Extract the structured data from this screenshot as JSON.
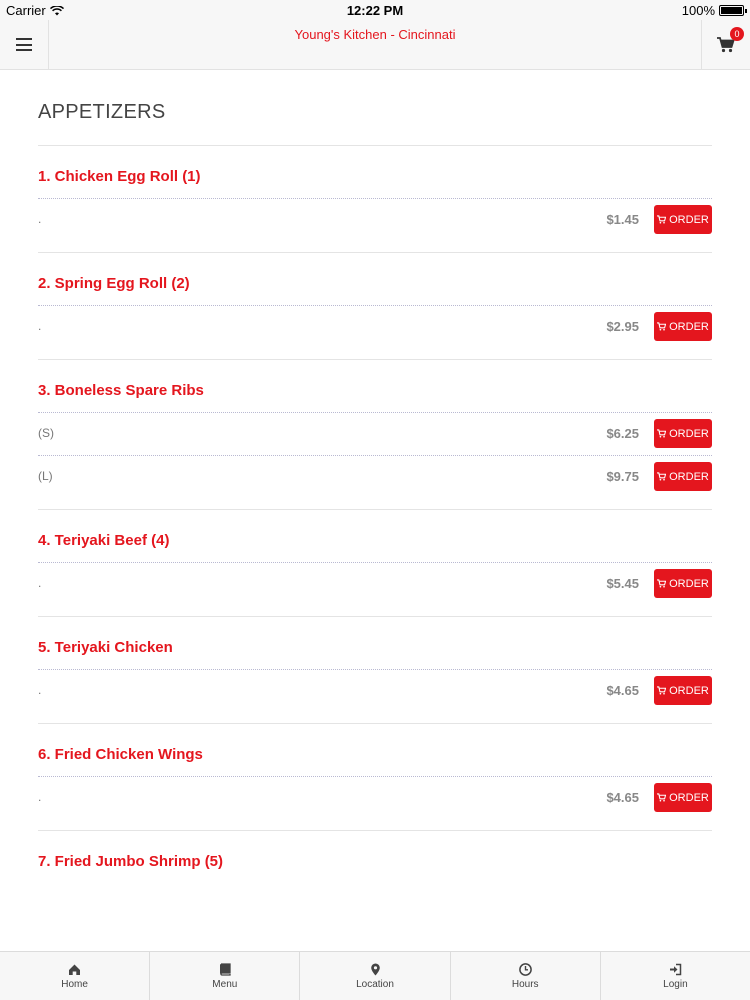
{
  "status_bar": {
    "carrier": "Carrier",
    "time": "12:22 PM",
    "battery": "100%"
  },
  "header": {
    "title": "Young's Kitchen - Cincinnati",
    "cart_count": "0"
  },
  "section": {
    "title": "APPETIZERS"
  },
  "order_label": "ORDER",
  "items": [
    {
      "name": "1. Chicken Egg Roll (1)",
      "variants": [
        {
          "label": ".",
          "price": "$1.45"
        }
      ]
    },
    {
      "name": "2. Spring Egg Roll (2)",
      "variants": [
        {
          "label": ".",
          "price": "$2.95"
        }
      ]
    },
    {
      "name": "3. Boneless Spare Ribs",
      "variants": [
        {
          "label": "(S)",
          "price": "$6.25"
        },
        {
          "label": "(L)",
          "price": "$9.75"
        }
      ]
    },
    {
      "name": "4. Teriyaki Beef (4)",
      "variants": [
        {
          "label": ".",
          "price": "$5.45"
        }
      ]
    },
    {
      "name": "5. Teriyaki Chicken",
      "variants": [
        {
          "label": ".",
          "price": "$4.65"
        }
      ]
    },
    {
      "name": "6. Fried Chicken Wings",
      "variants": [
        {
          "label": ".",
          "price": "$4.65"
        }
      ]
    },
    {
      "name": "7. Fried Jumbo Shrimp (5)",
      "variants": []
    }
  ],
  "tabs": [
    {
      "label": "Home",
      "icon": "home-icon"
    },
    {
      "label": "Menu",
      "icon": "book-icon"
    },
    {
      "label": "Location",
      "icon": "map-pin-icon"
    },
    {
      "label": "Hours",
      "icon": "clock-icon"
    },
    {
      "label": "Login",
      "icon": "login-icon"
    }
  ],
  "colors": {
    "accent": "#e4161e",
    "text": "#444444",
    "bar_bg": "#f7f7f7"
  }
}
